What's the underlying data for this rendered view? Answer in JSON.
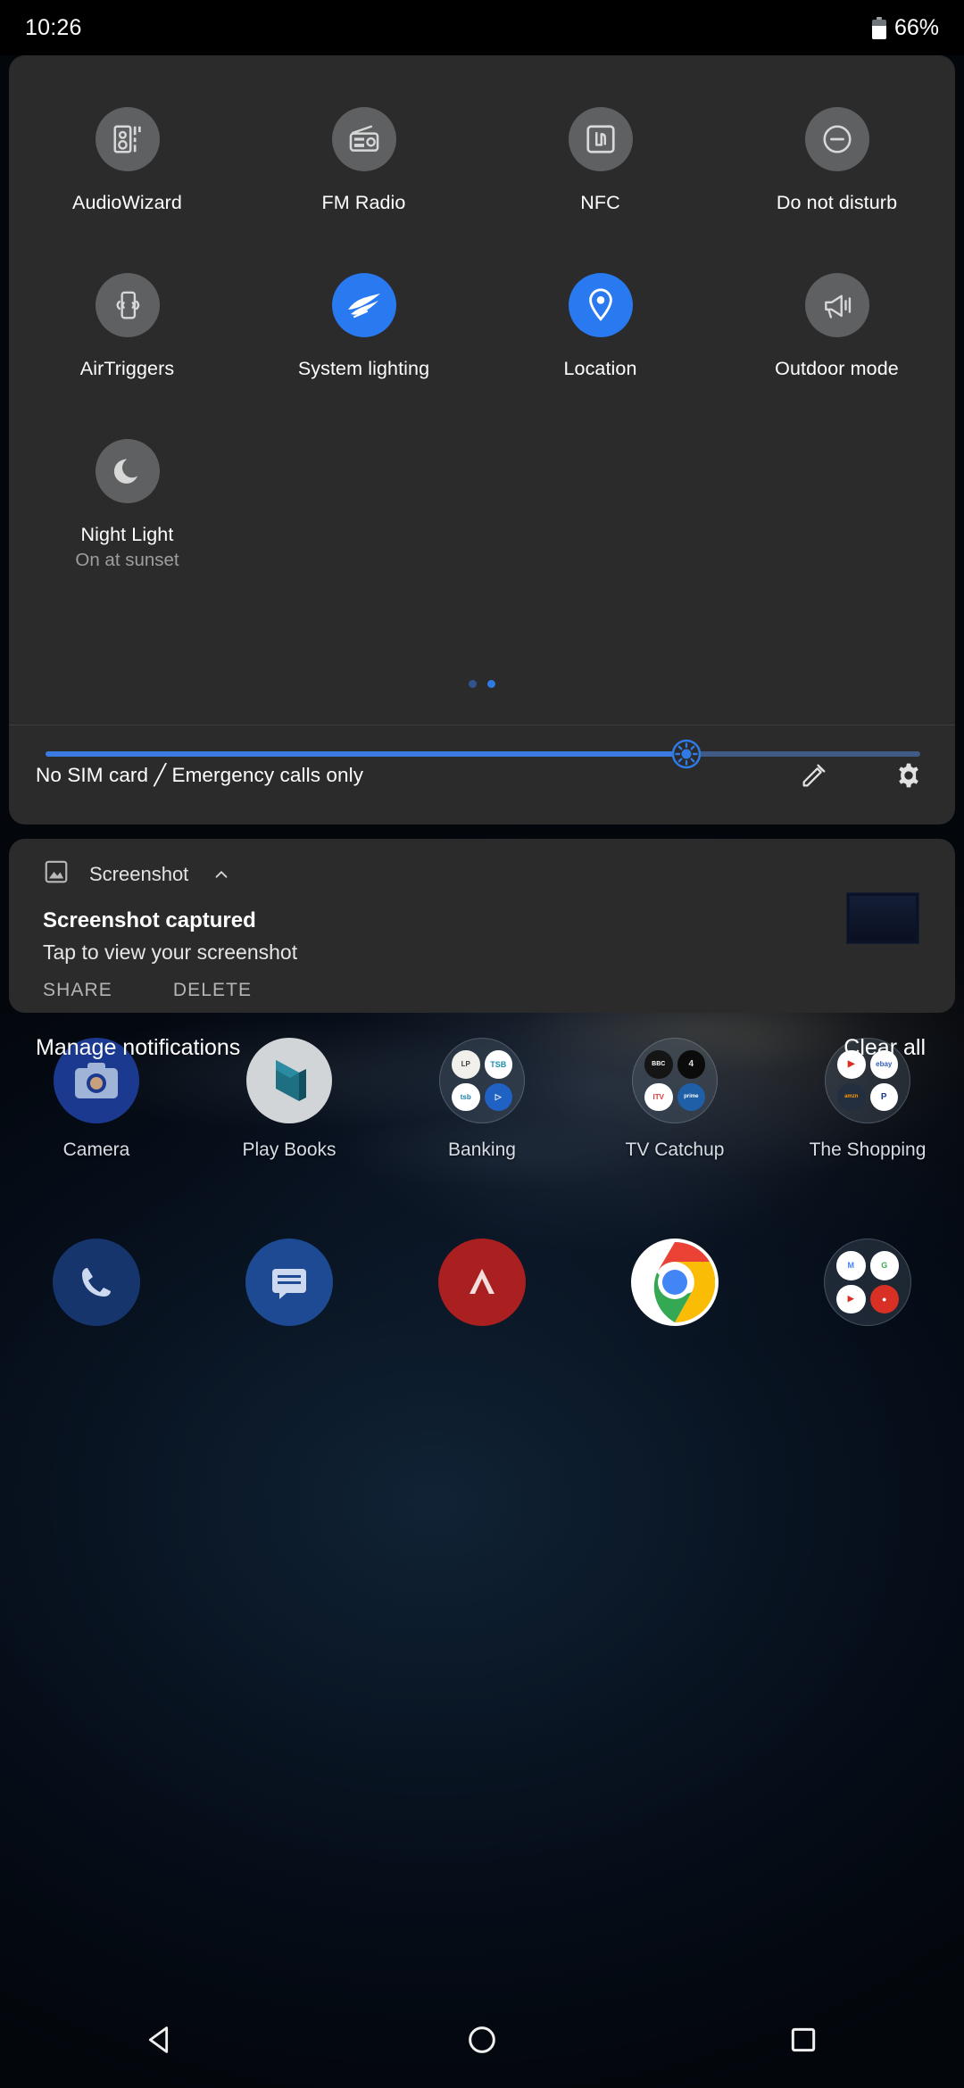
{
  "statusbar": {
    "time": "10:26",
    "battery_percent": "66%",
    "battery_level": 66
  },
  "quick_settings": {
    "tiles": [
      {
        "label": "AudioWizard",
        "sub": "",
        "active": false,
        "icon": "audiowizard-icon"
      },
      {
        "label": "FM Radio",
        "sub": "",
        "active": false,
        "icon": "radio-icon"
      },
      {
        "label": "NFC",
        "sub": "",
        "active": false,
        "icon": "nfc-icon"
      },
      {
        "label": "Do not disturb",
        "sub": "",
        "active": false,
        "icon": "do-not-disturb-icon"
      },
      {
        "label": "AirTriggers",
        "sub": "",
        "active": false,
        "icon": "airtriggers-icon"
      },
      {
        "label": "System lighting",
        "sub": "",
        "active": true,
        "icon": "rog-logo-icon"
      },
      {
        "label": "Location",
        "sub": "",
        "active": true,
        "icon": "location-pin-icon"
      },
      {
        "label": "Outdoor mode",
        "sub": "",
        "active": false,
        "icon": "megaphone-icon"
      },
      {
        "label": "Night Light",
        "sub": "On at sunset",
        "active": false,
        "icon": "moon-icon"
      }
    ],
    "pages": {
      "count": 2,
      "current": 2
    },
    "brightness": {
      "value": 74,
      "icon": "brightness-icon"
    },
    "footer": {
      "carrier_text": "No SIM card ╱ Emergency calls only",
      "edit_icon": "pencil-icon",
      "settings_icon": "gear-icon"
    },
    "accent_color": "#2979f0",
    "tile_inactive_color": "#5f6062",
    "panel_color": "#2b2b2b"
  },
  "notification": {
    "app_name": "Screenshot",
    "app_icon": "image-icon",
    "collapse_icon": "chevron-up-icon",
    "title": "Screenshot captured",
    "text": "Tap to view your screenshot",
    "thumbnail_name": "screenshot-thumbnail",
    "actions": [
      {
        "label": "SHARE",
        "name": "share-action"
      },
      {
        "label": "DELETE",
        "name": "delete-action"
      }
    ]
  },
  "shade_footer": {
    "manage_label": "Manage notifications",
    "clear_all_label": "Clear all"
  },
  "homescreen": {
    "apps": [
      {
        "label": "Camera",
        "type": "app",
        "icon": "camera-icon",
        "color": "#1b3a8f"
      },
      {
        "label": "Play Books",
        "type": "app",
        "icon": "play-books-icon",
        "color": "#d2d5d8"
      },
      {
        "label": "Banking",
        "type": "folder",
        "minis": [
          "LP",
          "TSB",
          "tsb",
          "PB"
        ]
      },
      {
        "label": "TV Catchup",
        "type": "folder",
        "minis": [
          "BBC",
          "4",
          "ITV",
          "PV"
        ]
      },
      {
        "label": "The Shopping",
        "type": "folder",
        "minis": [
          "PS",
          "eb",
          "az",
          "PP"
        ]
      }
    ],
    "dock": [
      {
        "name": "phone-app",
        "icon": "phone-icon",
        "color": "#1b3b78"
      },
      {
        "name": "messages-app",
        "icon": "messages-icon",
        "color": "#1b4b94"
      },
      {
        "name": "armoury-crate-app",
        "icon": "armoury-icon",
        "color": "#b02020"
      },
      {
        "name": "chrome-app",
        "icon": "chrome-icon",
        "color": "#ffffff"
      },
      {
        "name": "google-folder",
        "type": "folder",
        "minis": [
          "M",
          "G",
          "YT",
          "D"
        ]
      }
    ]
  },
  "navbar": {
    "back_label": "back-button",
    "home_label": "home-button",
    "recents_label": "recents-button"
  }
}
